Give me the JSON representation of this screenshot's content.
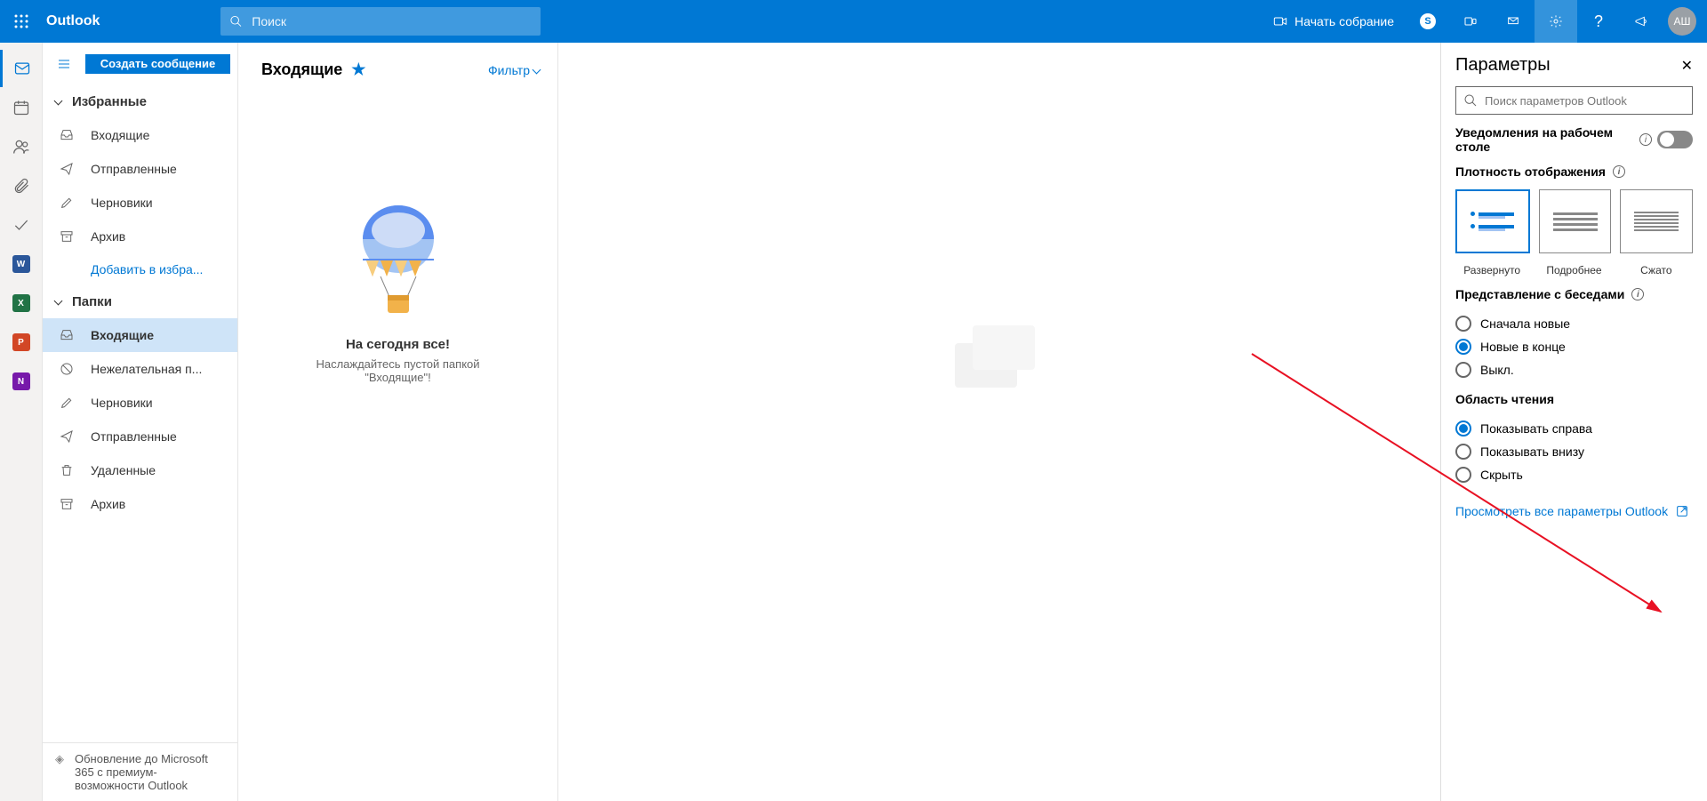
{
  "header": {
    "brand": "Outlook",
    "search_placeholder": "Поиск",
    "meet_label": "Начать собрание",
    "avatar_initials": "АШ"
  },
  "nav": {
    "new_message": "Создать сообщение",
    "favorites_header": "Избранные",
    "favorites": [
      {
        "label": "Входящие",
        "icon": "inbox"
      },
      {
        "label": "Отправленные",
        "icon": "sent"
      },
      {
        "label": "Черновики",
        "icon": "draft"
      },
      {
        "label": "Архив",
        "icon": "archive"
      }
    ],
    "add_favorite": "Добавить в избра...",
    "folders_header": "Папки",
    "folders": [
      {
        "label": "Входящие",
        "icon": "inbox",
        "selected": true
      },
      {
        "label": "Нежелательная п...",
        "icon": "spam"
      },
      {
        "label": "Черновики",
        "icon": "draft"
      },
      {
        "label": "Отправленные",
        "icon": "sent"
      },
      {
        "label": "Удаленные",
        "icon": "trash"
      },
      {
        "label": "Архив",
        "icon": "archive"
      }
    ],
    "upgrade_text": "Обновление до Microsoft 365 с премиум-возможности Outlook"
  },
  "list": {
    "title": "Входящие",
    "filter_label": "Фильтр",
    "empty_title": "На сегодня все!",
    "empty_subtitle": "Наслаждайтесь пустой папкой \"Входящие\"!"
  },
  "settings": {
    "title": "Параметры",
    "search_placeholder": "Поиск параметров Outlook",
    "desktop_notifications": "Уведомления на рабочем столе",
    "density_title": "Плотность отображения",
    "density_options": [
      "Развернуто",
      "Подробнее",
      "Сжато"
    ],
    "density_selected": 0,
    "conversations_title": "Представление с беседами",
    "conversations_options": [
      "Сначала новые",
      "Новые в конце",
      "Выкл."
    ],
    "conversations_selected": 1,
    "reading_pane_title": "Область чтения",
    "reading_pane_options": [
      "Показывать справа",
      "Показывать внизу",
      "Скрыть"
    ],
    "reading_pane_selected": 0,
    "view_all_link": "Просмотреть все параметры Outlook"
  }
}
